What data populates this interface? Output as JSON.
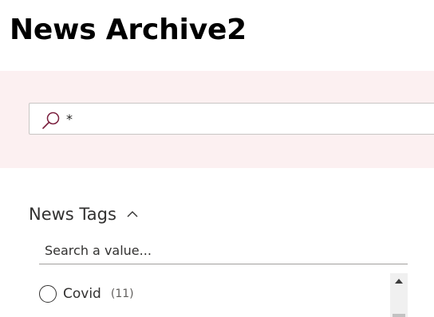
{
  "page": {
    "title": "News Archive2"
  },
  "search": {
    "query": "*"
  },
  "refiner": {
    "title": "News Tags",
    "value_search_placeholder": "Search a value...",
    "items": [
      {
        "label": "Covid",
        "count": "(11)"
      }
    ]
  },
  "colors": {
    "search_band_bg": "#fcf0f1",
    "accent": "#7a1f3d"
  },
  "icons": {
    "search": "search-icon",
    "collapse": "chevron-up-icon",
    "scroll_up": "scroll-up-arrow-icon"
  }
}
